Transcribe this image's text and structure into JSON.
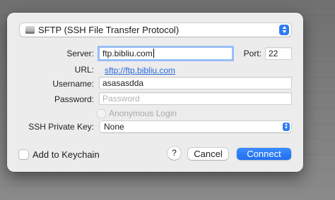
{
  "dialog": {
    "protocol": {
      "icon": "drive-icon",
      "label": "SFTP (SSH File Transfer Protocol)"
    },
    "server": {
      "label": "Server:",
      "value": "ftp.bibliu.com",
      "focused": true
    },
    "port": {
      "label": "Port:",
      "value": "22"
    },
    "url": {
      "label": "URL:",
      "value": "sftp://ftp.bibliu.com"
    },
    "username": {
      "label": "Username:",
      "value": "asasasdda"
    },
    "password": {
      "label": "Password:",
      "placeholder": "Password"
    },
    "anonymous_login": {
      "label": "Anonymous Login",
      "checked": false,
      "enabled": false
    },
    "ssh_key": {
      "label": "SSH Private Key:",
      "value": "None"
    },
    "keychain": {
      "label": "Add to Keychain",
      "checked": false
    },
    "help_label": "?",
    "cancel_label": "Cancel",
    "connect_label": "Connect"
  },
  "colors": {
    "accent": "#2f7bf5",
    "link": "#2a6bd9",
    "dialog_bg": "#ececec"
  }
}
